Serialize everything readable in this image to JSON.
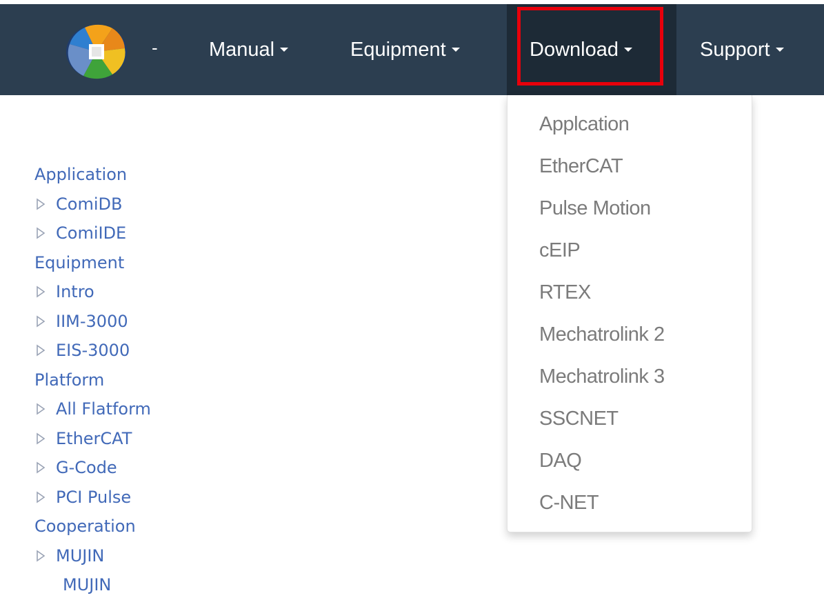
{
  "nav": {
    "brand_separator": "-",
    "items": [
      {
        "label": "Manual"
      },
      {
        "label": "Equipment"
      },
      {
        "label": "Download"
      },
      {
        "label": "Support"
      }
    ]
  },
  "dropdown": {
    "items": [
      {
        "label": "Applcation"
      },
      {
        "label": "EtherCAT"
      },
      {
        "label": "Pulse Motion"
      },
      {
        "label": "cEIP"
      },
      {
        "label": "RTEX"
      },
      {
        "label": "Mechatrolink 2"
      },
      {
        "label": "Mechatrolink 3"
      },
      {
        "label": "SSCNET"
      },
      {
        "label": "DAQ"
      },
      {
        "label": "C-NET"
      }
    ]
  },
  "sidebar": {
    "sections": [
      {
        "heading": "Application",
        "items": [
          "ComiDB",
          "ComiIDE"
        ]
      },
      {
        "heading": "Equipment",
        "items": [
          "Intro",
          "IIM-3000",
          "EIS-3000"
        ]
      },
      {
        "heading": "Platform",
        "items": [
          "All Flatform",
          "EtherCAT",
          "G-Code",
          "PCI Pulse"
        ]
      },
      {
        "heading": "Cooperation",
        "items": [
          "MUJIN"
        ]
      }
    ],
    "trailing": "MUJIN"
  },
  "colors": {
    "navbar_bg": "#2c3e50",
    "nav_active_bg": "#1d2a36",
    "highlight": "#e8000b",
    "link": "#4169b8",
    "dropdown_text": "#7b7b7b"
  }
}
